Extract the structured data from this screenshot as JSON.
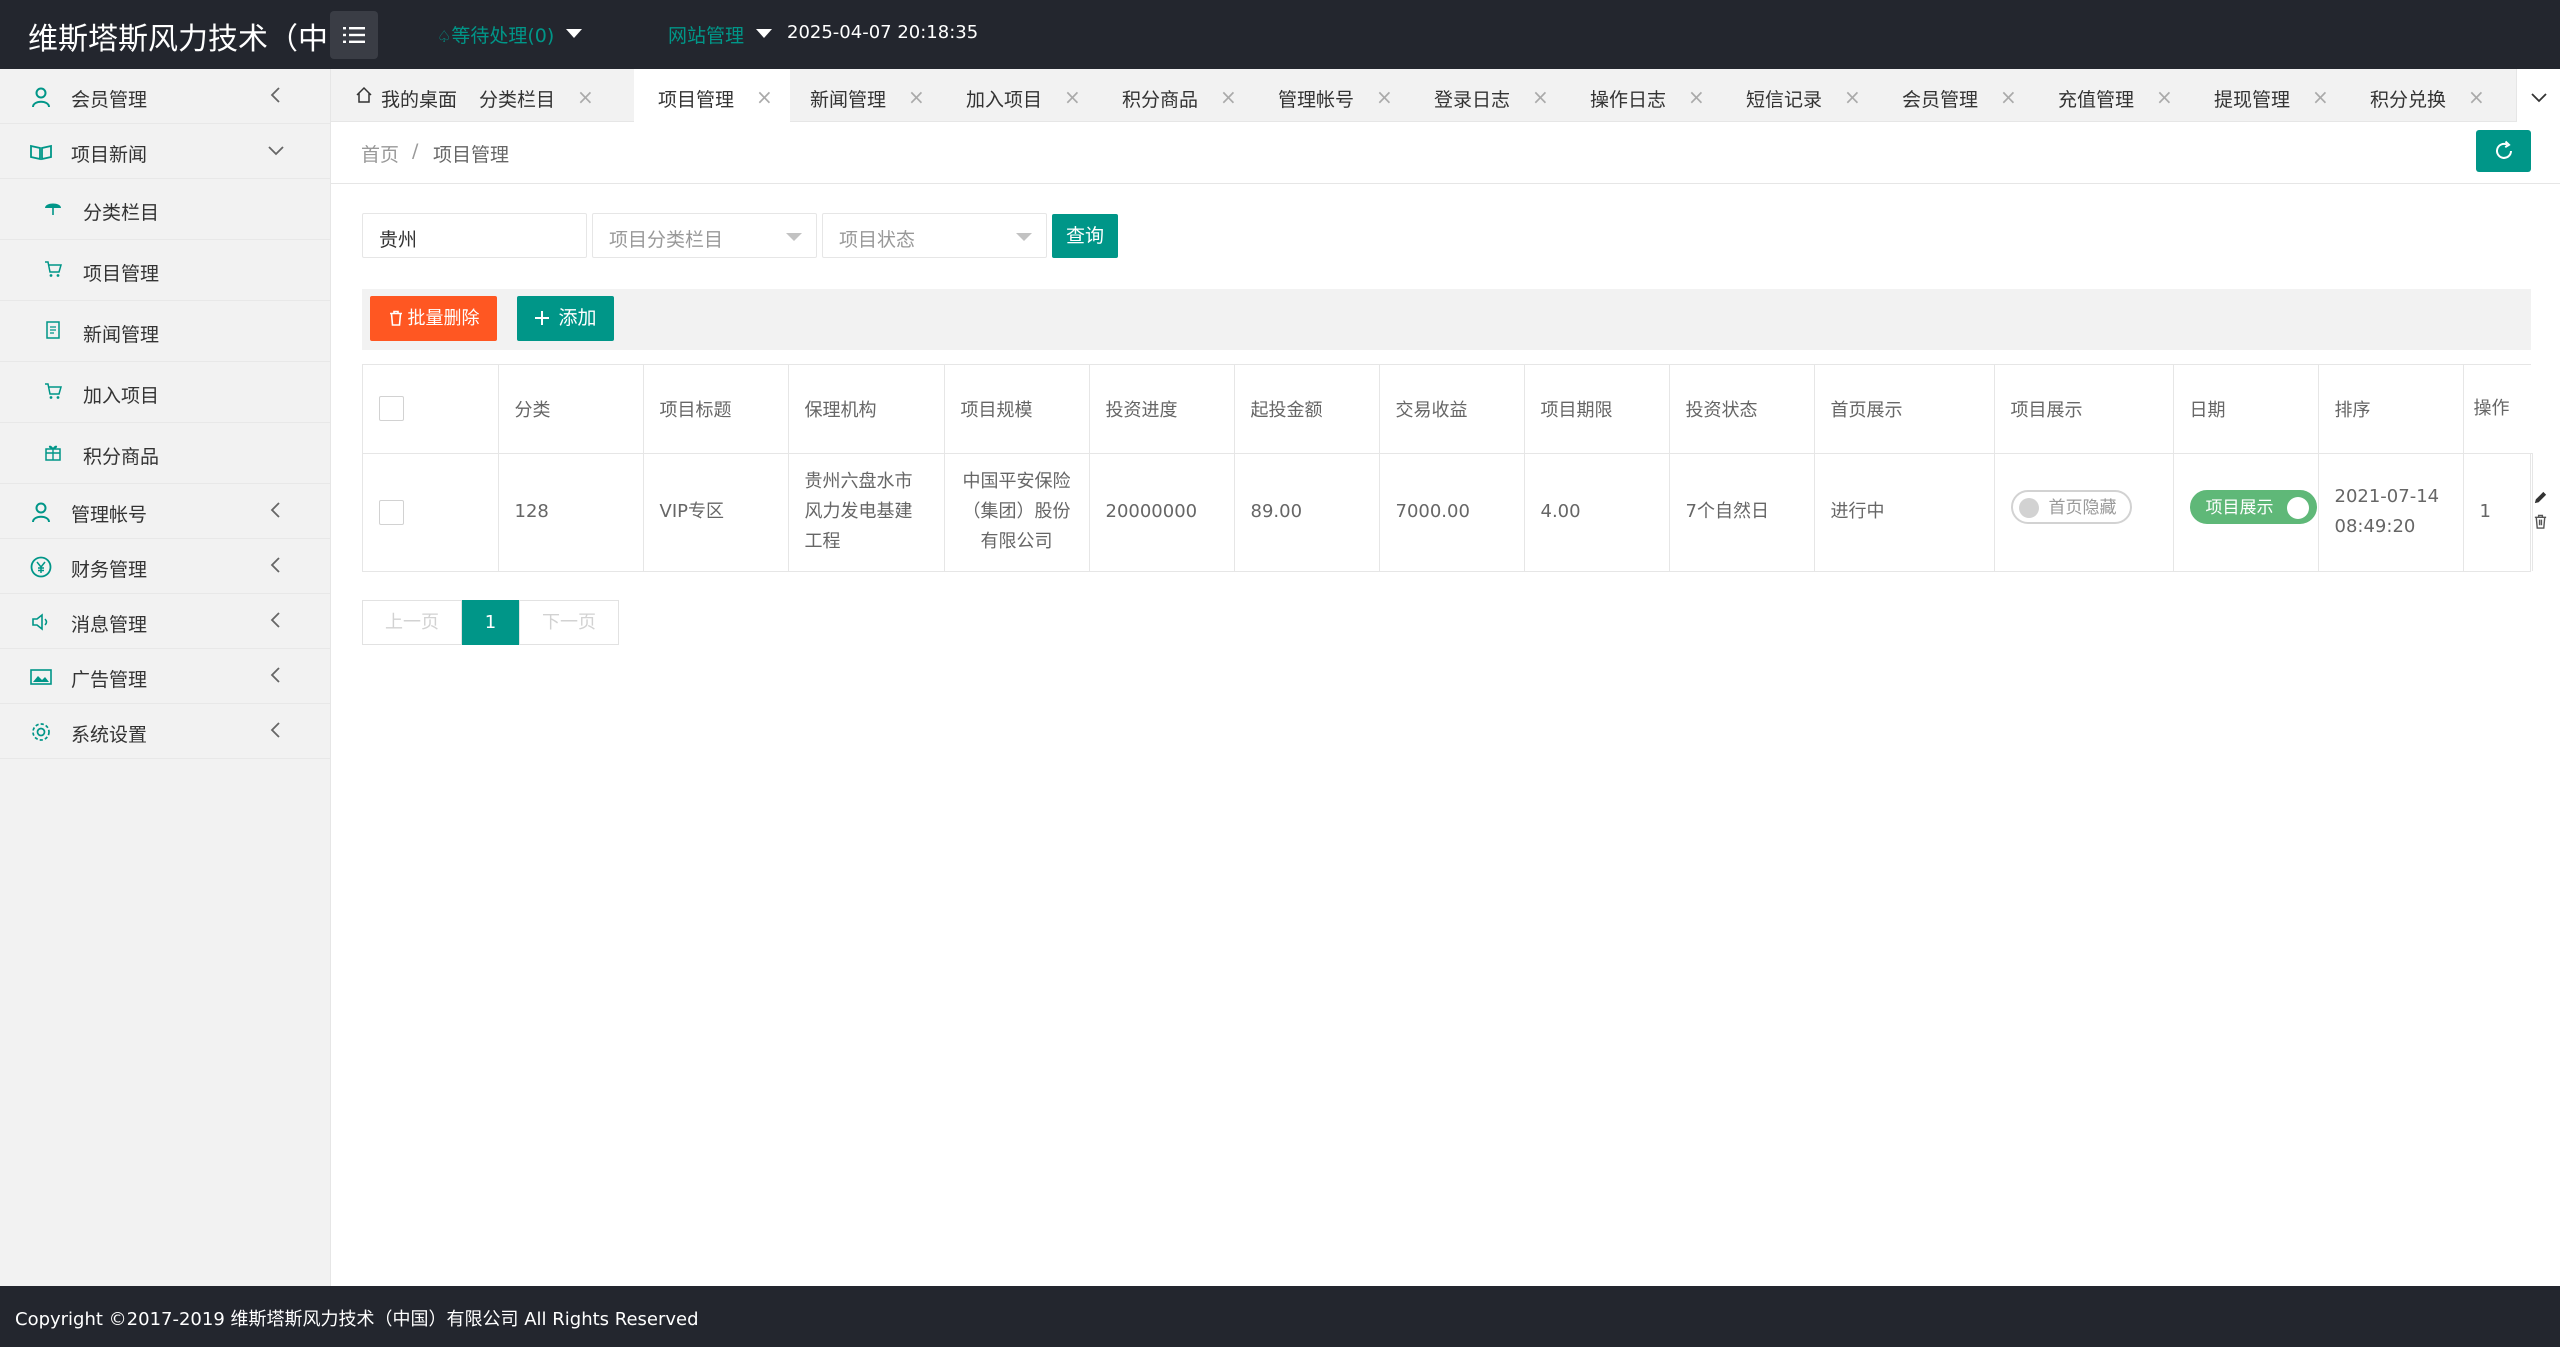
{
  "header": {
    "app_title": "维斯塔斯风力技术（中",
    "pending": "等待处理(0)",
    "site_manage": "网站管理",
    "datetime": "2025-04-07 20:18:35"
  },
  "sidebar": {
    "items": [
      {
        "label": "会员管理",
        "icon": "user-icon",
        "expanded": false
      },
      {
        "label": "项目新闻",
        "icon": "book-icon",
        "expanded": true,
        "children": [
          {
            "label": "分类栏目",
            "icon": "umbrella-icon"
          },
          {
            "label": "项目管理",
            "icon": "cart-icon"
          },
          {
            "label": "新闻管理",
            "icon": "document-icon"
          },
          {
            "label": "加入项目",
            "icon": "cart-icon"
          },
          {
            "label": "积分商品",
            "icon": "gift-icon"
          }
        ]
      },
      {
        "label": "管理帐号",
        "icon": "user-icon",
        "expanded": false
      },
      {
        "label": "财务管理",
        "icon": "yen-icon",
        "expanded": false
      },
      {
        "label": "消息管理",
        "icon": "speaker-icon",
        "expanded": false
      },
      {
        "label": "广告管理",
        "icon": "image-icon",
        "expanded": false
      },
      {
        "label": "系统设置",
        "icon": "gear-icon",
        "expanded": false
      }
    ]
  },
  "tabs": [
    {
      "label": "我的桌面",
      "home": true
    },
    {
      "label": "分类栏目"
    },
    {
      "label": "项目管理",
      "active": true
    },
    {
      "label": "新闻管理"
    },
    {
      "label": "加入项目"
    },
    {
      "label": "积分商品"
    },
    {
      "label": "管理帐号"
    },
    {
      "label": "登录日志"
    },
    {
      "label": "操作日志"
    },
    {
      "label": "短信记录"
    },
    {
      "label": "会员管理"
    },
    {
      "label": "充值管理"
    },
    {
      "label": "提现管理"
    },
    {
      "label": "积分兑换"
    }
  ],
  "breadcrumb": {
    "home": "首页",
    "separator": "/",
    "current": "项目管理"
  },
  "search": {
    "keyword_value": "贵州",
    "category_placeholder": "项目分类栏目",
    "status_placeholder": "项目状态",
    "query_label": "查询"
  },
  "toolbar": {
    "batch_delete_label": "批量删除",
    "add_label": "添加"
  },
  "table": {
    "columns": [
      "分类",
      "项目标题",
      "保理机构",
      "项目规模",
      "投资进度",
      "起投金额",
      "交易收益",
      "项目期限",
      "投资状态",
      "首页展示",
      "项目展示",
      "日期",
      "排序",
      "操作"
    ],
    "rows": [
      {
        "id": "128",
        "category": "VIP专区",
        "title": "贵州六盘水市风力发电基建工程",
        "agency": "中国平安保险（集团）股份有限公司",
        "scale": "20000000",
        "progress": "89.00",
        "min_amount": "7000.00",
        "yield": "4.00",
        "term": "7个自然日",
        "status": "进行中",
        "home_display": "首页隐藏",
        "home_display_on": false,
        "project_display": "项目展示",
        "project_display_on": true,
        "date": "2021-07-14",
        "time": "08:49:20",
        "sort": "1"
      }
    ]
  },
  "pager": {
    "prev": "上一页",
    "current": "1",
    "next": "下一页"
  },
  "footer": {
    "copyright": "Copyright ©2017-2019 维斯塔斯风力技术（中国）有限公司 All Rights Reserved"
  },
  "colors": {
    "primary": "#009688",
    "danger": "#ff5722",
    "switch_on": "#5fb878",
    "header_bg": "#23262e"
  }
}
